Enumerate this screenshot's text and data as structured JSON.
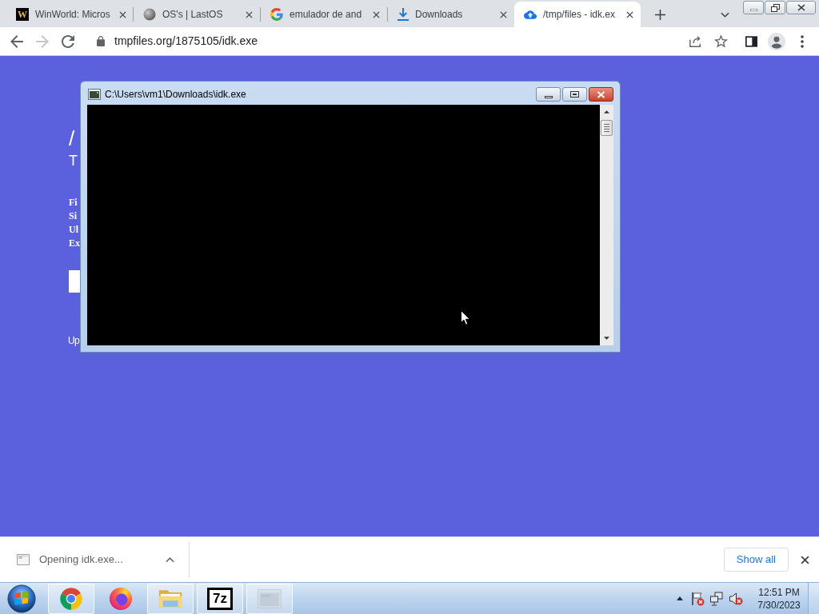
{
  "browser": {
    "tabs": [
      {
        "kind": "winworld",
        "favicon_letter": "W",
        "title": "WinWorld: Micros",
        "selected": false
      },
      {
        "kind": "sphere",
        "title": "OS's | LastOS",
        "selected": false
      },
      {
        "kind": "google",
        "title": "emulador de and",
        "selected": false
      },
      {
        "kind": "download",
        "title": "Downloads",
        "selected": false
      },
      {
        "kind": "cloud",
        "title": "/tmp/files - idk.ex",
        "selected": true
      }
    ],
    "forward_disabled": true,
    "url": "tmpfiles.org/1875105/idk.exe"
  },
  "page": {
    "heading": "/",
    "subheading": "T",
    "details": [
      "Fi",
      "Si",
      "Ul",
      "Ex"
    ],
    "footer": "Up"
  },
  "console_window": {
    "title": "C:\\Users\\vm1\\Downloads\\idk.exe"
  },
  "download_bar": {
    "item": "Opening idk.exe...",
    "show_all": "Show all"
  },
  "taskbar": {
    "apps": [
      {
        "kind": "chrome",
        "running": true
      },
      {
        "kind": "firefox",
        "running": false
      },
      {
        "kind": "explorer",
        "running": true
      },
      {
        "kind": "sevenzip",
        "label": "7z",
        "running": true
      },
      {
        "kind": "console",
        "running": true
      }
    ],
    "clock": {
      "time": "12:51 PM",
      "date": "7/30/2023"
    }
  }
}
